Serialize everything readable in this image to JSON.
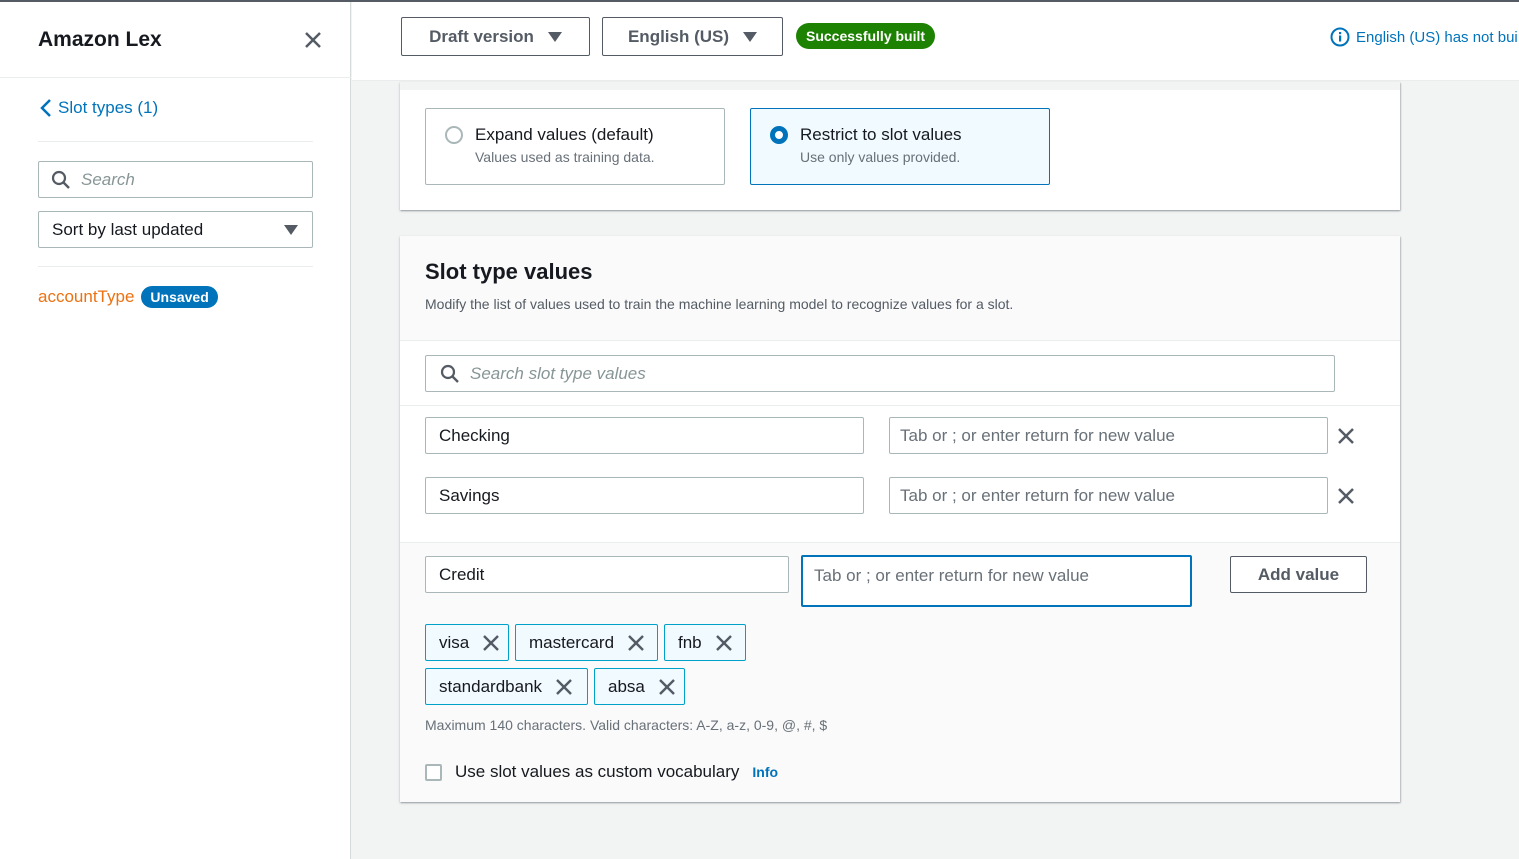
{
  "sidebar": {
    "title": "Amazon Lex",
    "back_label": "Slot types (1)",
    "search_placeholder": "Search",
    "sort_label": "Sort by last updated",
    "item": {
      "name": "accountType",
      "badge": "Unsaved"
    }
  },
  "topbar": {
    "version_label": "Draft version",
    "language_label": "English (US)",
    "status_badge": "Successfully built",
    "notice": "English (US) has not bui"
  },
  "resolution": {
    "options": [
      {
        "title": "Expand values (default)",
        "desc": "Values used as training data.",
        "selected": false
      },
      {
        "title": "Restrict to slot values",
        "desc": "Use only values provided.",
        "selected": true
      }
    ]
  },
  "slot_values": {
    "title": "Slot type values",
    "description": "Modify the list of values used to train the machine learning model to recognize values for a slot.",
    "search_placeholder": "Search slot type values",
    "synonym_placeholder": "Tab or ; or enter  return for new value",
    "rows": [
      {
        "value": "Checking"
      },
      {
        "value": "Savings"
      }
    ],
    "active_row": {
      "value": "Credit",
      "synonyms": [
        "visa",
        "mastercard",
        "fnb",
        "standardbank",
        "absa"
      ]
    },
    "add_button": "Add value",
    "hint": "Maximum 140 characters. Valid characters: A-Z, a-z, 0-9, @, #, $",
    "vocab_label": "Use slot values as custom vocabulary",
    "info_link": "Info"
  },
  "colors": {
    "accent": "#0073bb",
    "success": "#1d8102",
    "orange": "#ec7211"
  }
}
